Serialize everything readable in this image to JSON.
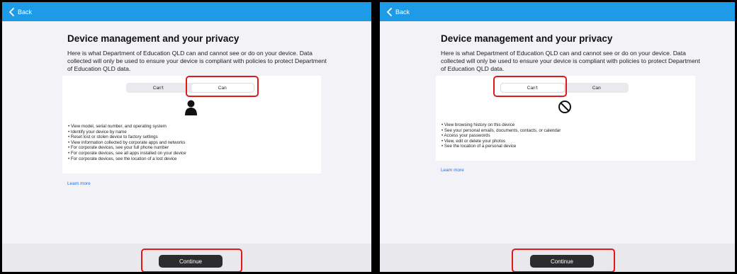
{
  "header": {
    "back_label": "Back"
  },
  "page": {
    "title": "Device management and your privacy",
    "description": "Here is what Department of Education QLD can and cannot see or do on your device. Data collected will only be used to ensure your device is compliant with policies to protect Department of Education QLD data."
  },
  "segment": {
    "cant_label": "Can't",
    "can_label": "Can"
  },
  "can_items": [
    "View model, serial number, and operating system",
    "Identify your device by name",
    "Reset lost or stolen device to factory settings",
    "View information collected by corporate apps and networks",
    "For corporate devices, see your full phone number",
    "For corporate devices, see all apps installed on your device",
    "For corporate devices, see the location of a lost device"
  ],
  "cant_items": [
    "View browsing history on this device",
    "See your personal emails, documents, contacts, or calendar",
    "Access your passwords",
    "View, edit or delete your photos",
    "See the location of a personal device"
  ],
  "learn_more": "Learn more",
  "continue_label": "Continue",
  "colors": {
    "topbar": "#1e9be6",
    "highlight": "#e0191b",
    "button": "#2c2c2e",
    "link": "#1a73e8"
  },
  "icons": {
    "can": "person-icon",
    "cant": "prohibited-icon",
    "back": "chevron-left-icon"
  }
}
